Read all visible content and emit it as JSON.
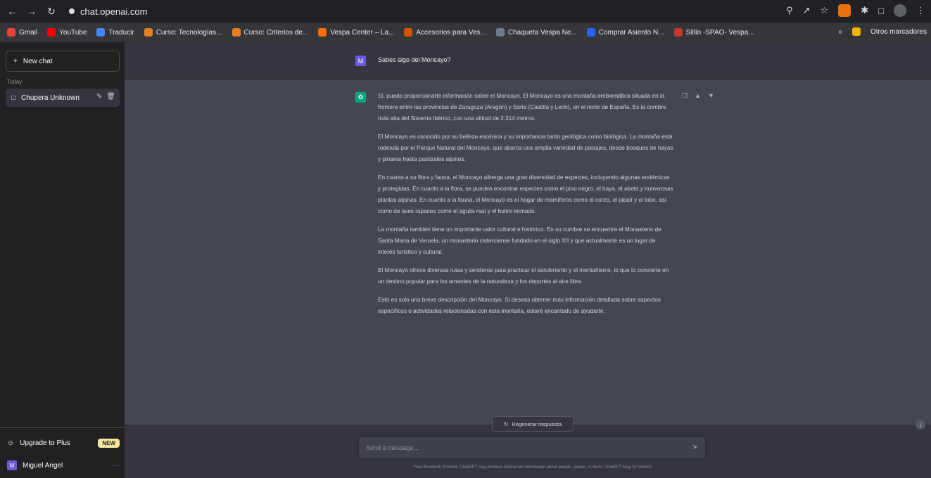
{
  "browser": {
    "url": "chat.openai.com",
    "bookmarks": [
      {
        "label": "Gmail",
        "color": "#ea4335"
      },
      {
        "label": "YouTube",
        "color": "#ff0000"
      },
      {
        "label": "Traducir",
        "color": "#4285f4"
      },
      {
        "label": "Curso: Tecnologías...",
        "color": "#e67e22"
      },
      {
        "label": "Curso: Criterios de...",
        "color": "#e67e22"
      },
      {
        "label": "Vespa Center – La...",
        "color": "#ff6d00"
      },
      {
        "label": "Accesorios para Ves...",
        "color": "#d35400"
      },
      {
        "label": "Chaqueta Vespa Ne...",
        "color": "#6c7a89"
      },
      {
        "label": "Comprar Asiento N...",
        "color": "#2962ff"
      },
      {
        "label": "Sillín -SPAO- Vespa...",
        "color": "#c0392b"
      }
    ],
    "other_bookmarks": "Otros marcadores"
  },
  "sidebar": {
    "new_chat": "New chat",
    "section_label": "Today",
    "conversation": "Chupera Unknown",
    "upgrade_label": "Upgrade to Plus",
    "new_badge": "NEW",
    "user_name": "Miguel Angel",
    "user_initial": "M"
  },
  "chat": {
    "user_initial": "M",
    "user_message": "Sabes algo del Moncayo?",
    "bot_paragraphs": [
      "Sí, puedo proporcionarte información sobre el Moncayo. El Moncayo es una montaña emblemática situada en la frontera entre las provincias de Zaragoza (Aragón) y Soria (Castilla y León), en el norte de España. Es la cumbre más alta del Sistema Ibérico, con una altitud de 2.314 metros.",
      "El Moncayo es conocido por su belleza escénica y su importancia tanto geológica como biológica. La montaña está rodeada por el Parque Natural del Moncayo, que abarca una amplia variedad de paisajes, desde bosques de hayas y pinares hasta pastizales alpinos.",
      "En cuanto a su flora y fauna, el Moncayo alberga una gran diversidad de especies, incluyendo algunas endémicas y protegidas. En cuanto a la flora, se pueden encontrar especies como el pino negro, el haya, el abeto y numerosas plantas alpinas. En cuanto a la fauna, el Moncayo es el hogar de mamíferos como el corzo, el jabalí y el lobo, así como de aves rapaces como el águila real y el buitre leonado.",
      "La montaña también tiene un importante valor cultural e histórico. En su cumbre se encuentra el Monasterio de Santa María de Veruela, un monasterio cisterciense fundado en el siglo XII y que actualmente es un lugar de interés turístico y cultural.",
      "El Moncayo ofrece diversas rutas y senderos para practicar el senderismo y el montañismo, lo que lo convierte en un destino popular para los amantes de la naturaleza y los deportes al aire libre.",
      "Esto es solo una breve descripción del Moncayo. Si deseas obtener más información detallada sobre aspectos específicos o actividades relacionadas con esta montaña, estaré encantado de ayudarte."
    ],
    "regenerate_label": "Regenerar respuesta",
    "input_placeholder": "Send a message...",
    "footer": "Free Research Preview. ChatGPT may produce inaccurate information about people, places, or facts. ChatGPT May 24 Version"
  },
  "colors": {
    "assistant_avatar": "#10a37f",
    "user_avatar": "#6b5cd6",
    "sidebar": "#202123",
    "main": "#343541",
    "bot_row": "#444654"
  }
}
